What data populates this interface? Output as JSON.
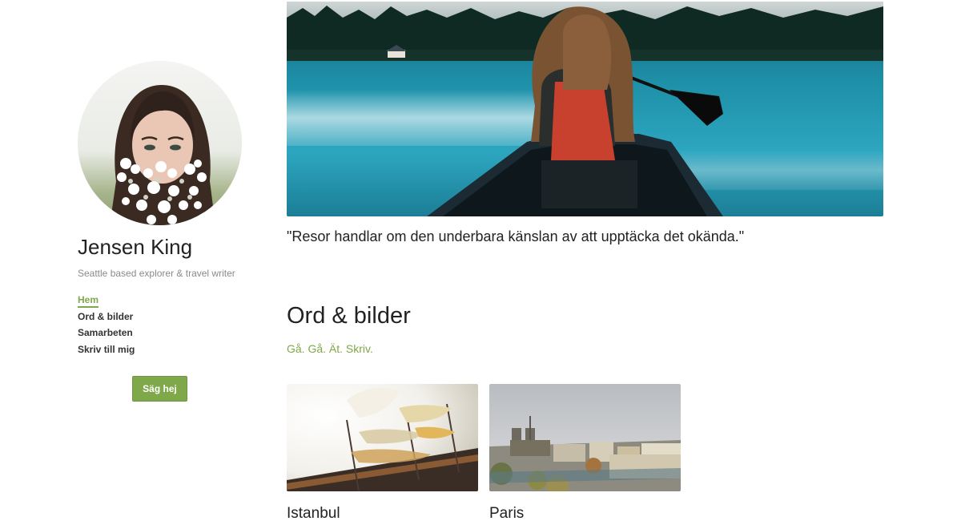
{
  "author": {
    "name": "Jensen King",
    "tagline": "Seattle based explorer & travel writer"
  },
  "nav": {
    "items": [
      {
        "label": "Hem",
        "active": true
      },
      {
        "label": "Ord & bilder"
      },
      {
        "label": "Samarbeten"
      },
      {
        "label": "Skriv till mig"
      }
    ]
  },
  "cta": {
    "label": "Säg hej"
  },
  "hero": {
    "quote": "\"Resor handlar om den underbara känslan av att upptäcka det okända.\""
  },
  "section": {
    "title": "Ord & bilder",
    "subtitle": "Gå. Gå. Ät. Skriv."
  },
  "cards": [
    {
      "title": "Istanbul"
    },
    {
      "title": "Paris"
    }
  ],
  "colors": {
    "accent": "#7fa84a"
  }
}
